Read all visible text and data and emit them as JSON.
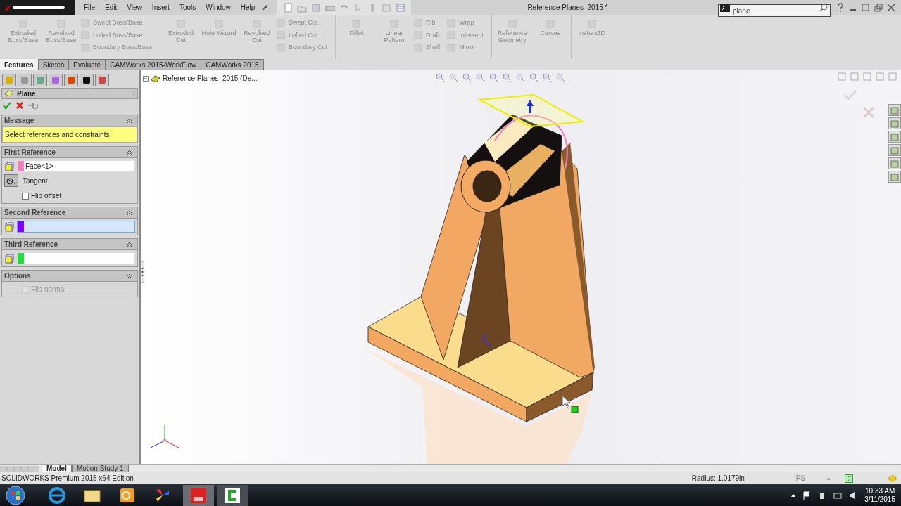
{
  "title_bar": {
    "menu": [
      "File",
      "Edit",
      "View",
      "Insert",
      "Tools",
      "Window",
      "Help"
    ],
    "document_title": "Reference Planes_2015 *",
    "search": {
      "value": "plane"
    }
  },
  "ribbon": [
    {
      "items": [
        {
          "kind": "large",
          "label": "Extruded Boss/Base",
          "disabled": true
        },
        {
          "kind": "large",
          "label": "Revolved Boss/Base",
          "disabled": true
        },
        {
          "kind": "stack",
          "items": [
            {
              "label": "Swept Boss/Base",
              "disabled": true
            },
            {
              "label": "Lofted Boss/Base",
              "disabled": true
            },
            {
              "label": "Boundary Boss/Base",
              "disabled": true
            }
          ]
        }
      ]
    },
    {
      "items": [
        {
          "kind": "large",
          "label": "Extruded Cut",
          "disabled": true
        },
        {
          "kind": "large",
          "label": "Hole Wizard",
          "disabled": true
        },
        {
          "kind": "large",
          "label": "Revolved Cut",
          "disabled": true
        },
        {
          "kind": "stack",
          "items": [
            {
              "label": "Swept Cut",
              "disabled": true
            },
            {
              "label": "Lofted Cut",
              "disabled": true
            },
            {
              "label": "Boundary Cut",
              "disabled": true
            }
          ]
        }
      ]
    },
    {
      "items": [
        {
          "kind": "large",
          "label": "Fillet",
          "disabled": true
        },
        {
          "kind": "large",
          "label": "Linear Pattern",
          "disabled": true
        },
        {
          "kind": "stack",
          "items": [
            {
              "label": "Rib",
              "disabled": true
            },
            {
              "label": "Draft",
              "disabled": true
            },
            {
              "label": "Shell",
              "disabled": true
            }
          ]
        },
        {
          "kind": "stack",
          "items": [
            {
              "label": "Wrap",
              "disabled": true
            },
            {
              "label": "Intersect",
              "disabled": true
            },
            {
              "label": "Mirror",
              "disabled": true
            }
          ]
        }
      ]
    },
    {
      "items": [
        {
          "kind": "large",
          "label": "Reference Geometry",
          "disabled": true
        },
        {
          "kind": "large",
          "label": "Curves",
          "disabled": true
        }
      ]
    },
    {
      "items": [
        {
          "kind": "large",
          "label": "Instant3D",
          "disabled": true
        }
      ]
    }
  ],
  "command_tabs": [
    {
      "label": "Features",
      "selected": true
    },
    {
      "label": "Sketch",
      "selected": false
    },
    {
      "label": "Evaluate",
      "selected": false
    },
    {
      "label": "CAMWorks 2015-WorkFlow",
      "selected": false
    },
    {
      "label": "CAMWorks 2015",
      "selected": false
    }
  ],
  "property_manager": {
    "title": "Plane",
    "help": "?",
    "message": {
      "title": "Message",
      "text": "Select references and constraints"
    },
    "references": [
      {
        "title": "First Reference",
        "value": "Face<1>",
        "color": "#f080c0",
        "active": false,
        "constraint": "Tangent",
        "checkbox": {
          "label": "Flip offset",
          "checked": false
        }
      },
      {
        "title": "Second Reference",
        "color": "#8000ff",
        "active": true
      },
      {
        "title": "Third Reference",
        "color": "#20e040",
        "active": false
      }
    ],
    "options": {
      "title": "Options",
      "checkbox": {
        "label": "Flip normal",
        "checked": false,
        "disabled": true
      }
    }
  },
  "feature_tree": {
    "root": "Reference Planes_2015  (De..."
  },
  "bottom_tabs": [
    {
      "label": "Model",
      "selected": true
    },
    {
      "label": "Motion Study 1",
      "selected": false
    }
  ],
  "status_bar": {
    "edition": "SOLIDWORKS Premium 2015 x64 Edition",
    "measurement": "Radius: 1.0179in",
    "units": "IPS",
    "help": "?"
  },
  "taskbar": {
    "time": "10:33 AM",
    "date": "3/11/2015"
  }
}
